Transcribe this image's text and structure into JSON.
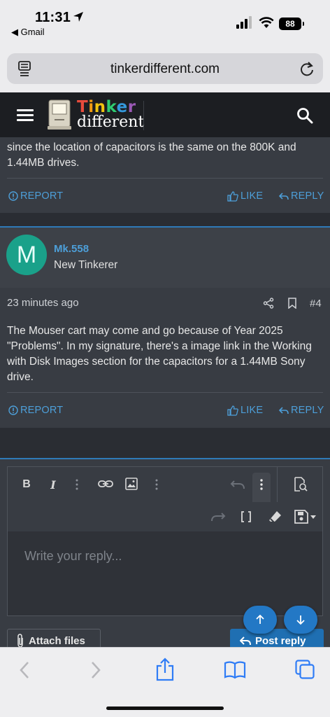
{
  "status_bar": {
    "time": "11:31",
    "back_app": "◀ Gmail",
    "battery": "88"
  },
  "browser": {
    "url": "tinkerdifferent.com"
  },
  "site": {
    "logo_line1": "Tinker",
    "logo_line2": "different",
    "logo_letter_colors": [
      "#e84b3c",
      "#f39c12",
      "#f1c40f",
      "#2ecc71",
      "#3498db",
      "#9b59b6"
    ]
  },
  "post1": {
    "text": "since the location of capacitors is the same on the 800K and 1.44MB drives.",
    "report": "REPORT",
    "like": "LIKE",
    "reply": "REPLY"
  },
  "post2": {
    "avatar_letter": "M",
    "username": "Mk.558",
    "user_title": "New Tinkerer",
    "date": "23 minutes ago",
    "number": "#4",
    "text": "The Mouser cart may come and go because of Year 2025 \"Problems\". In my signature, there's a image link in the Working with Disk Images section for the capacitors for a 1.44MB Sony drive.",
    "report": "REPORT",
    "like": "LIKE",
    "reply": "REPLY"
  },
  "editor": {
    "placeholder": "Write your reply...",
    "bold": "B",
    "italic": "I",
    "attach_label": "Attach files",
    "post_reply_label": "Post reply"
  },
  "colors": {
    "accent": "#4d9fd9",
    "avatar_bg": "#1aa18a",
    "button_blue": "#1f6fb2"
  }
}
